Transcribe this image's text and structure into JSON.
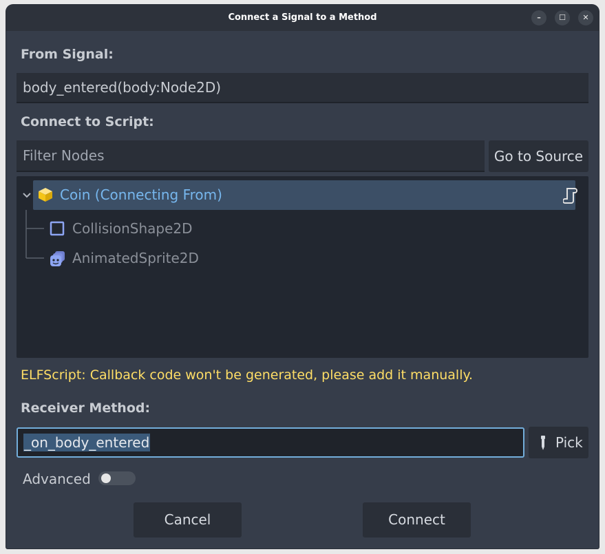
{
  "window": {
    "title": "Connect a Signal to a Method",
    "minimize_label": "–",
    "maximize_label": "☐",
    "close_label": "✕"
  },
  "from_signal": {
    "label": "From Signal:",
    "value": "body_entered(body:Node2D)"
  },
  "connect_to_script": {
    "label": "Connect to Script:",
    "filter_placeholder": "Filter Nodes",
    "go_to_source_label": "Go to Source"
  },
  "tree": {
    "items": [
      {
        "label": "Coin (Connecting From)",
        "icon": "node3d-cube-icon",
        "selected": true
      },
      {
        "label": "CollisionShape2D",
        "icon": "collision-shape-icon",
        "selected": false
      },
      {
        "label": "AnimatedSprite2D",
        "icon": "animated-sprite-icon",
        "selected": false
      }
    ]
  },
  "warning": "ELFScript: Callback code won't be generated, please add it manually.",
  "receiver": {
    "label": "Receiver Method:",
    "value": "_on_body_entered",
    "pick_label": "Pick"
  },
  "advanced": {
    "label": "Advanced",
    "enabled": false
  },
  "buttons": {
    "cancel_label": "Cancel",
    "connect_label": "Connect"
  },
  "colors": {
    "accent": "#73aedb",
    "warning": "#ffde66",
    "selected_row": "#3c4f66",
    "selected_text": "#77b7ee",
    "dimmed_text": "#8b9099"
  }
}
